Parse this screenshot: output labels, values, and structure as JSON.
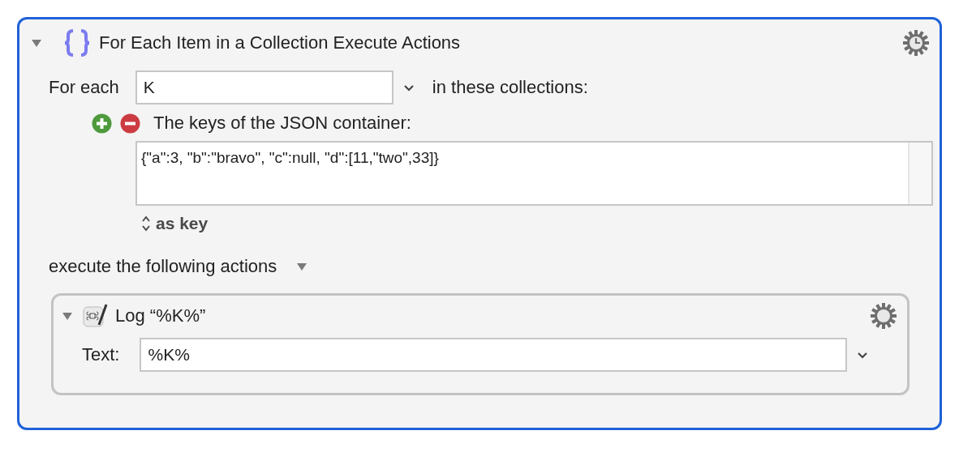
{
  "action": {
    "title": "For Each Item in a Collection Execute Actions",
    "expanded": true,
    "variable_label": "For each",
    "variable_value": "K",
    "collections_label": "in these collections:",
    "collection": {
      "description": "The keys of the JSON container:",
      "value": "{\"a\":3, \"b\":\"bravo\", \"c\":null, \"d\":[11,\"two\",33]}",
      "mode": "as key"
    },
    "actions_label": "execute the following actions",
    "actions_expanded": true,
    "actions": [
      {
        "title": "Log “%K%”",
        "expanded": true,
        "field_label": "Text:",
        "field_value": "%K%"
      }
    ]
  }
}
